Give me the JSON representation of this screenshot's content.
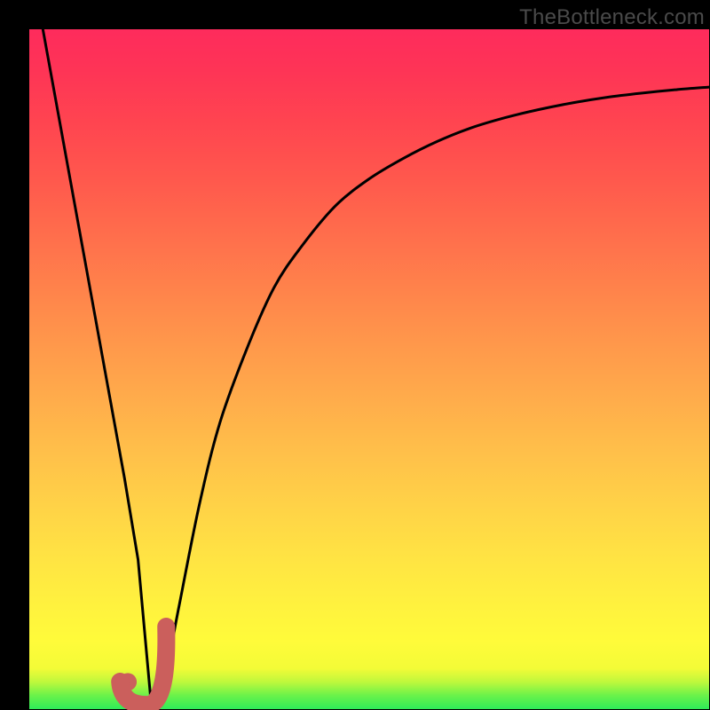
{
  "watermark": "TheBottleneck.com",
  "colors": {
    "frame": "#000000",
    "curve": "#000000",
    "marker_stroke": "#cb5f5c",
    "marker_fill": "#cb5f5c",
    "gradient_top": "#fe2b5c",
    "gradient_bottom": "#2eec58"
  },
  "chart_data": {
    "type": "line",
    "title": "",
    "xlabel": "",
    "ylabel": "",
    "xlim": [
      0,
      100
    ],
    "ylim": [
      0,
      100
    ],
    "grid": false,
    "legend": false,
    "series": [
      {
        "name": "bottleneck-curve",
        "x": [
          2,
          4,
          6,
          8,
          10,
          12,
          14,
          16,
          17,
          18,
          20,
          22,
          25,
          28,
          32,
          36,
          40,
          45,
          50,
          55,
          60,
          65,
          70,
          75,
          80,
          85,
          90,
          95,
          100
        ],
        "values": [
          100,
          89,
          78,
          67,
          56,
          45,
          34,
          22,
          11,
          0,
          5,
          15,
          30,
          42,
          53,
          62,
          68,
          74,
          78,
          81,
          83.5,
          85.5,
          87,
          88.2,
          89.2,
          90,
          90.6,
          91.1,
          91.5
        ]
      }
    ],
    "marker": {
      "name": "optimal-point",
      "shape": "J-hook",
      "center_x": 17,
      "center_y": 3,
      "dot": {
        "x": 14.5,
        "y": 4
      }
    }
  }
}
